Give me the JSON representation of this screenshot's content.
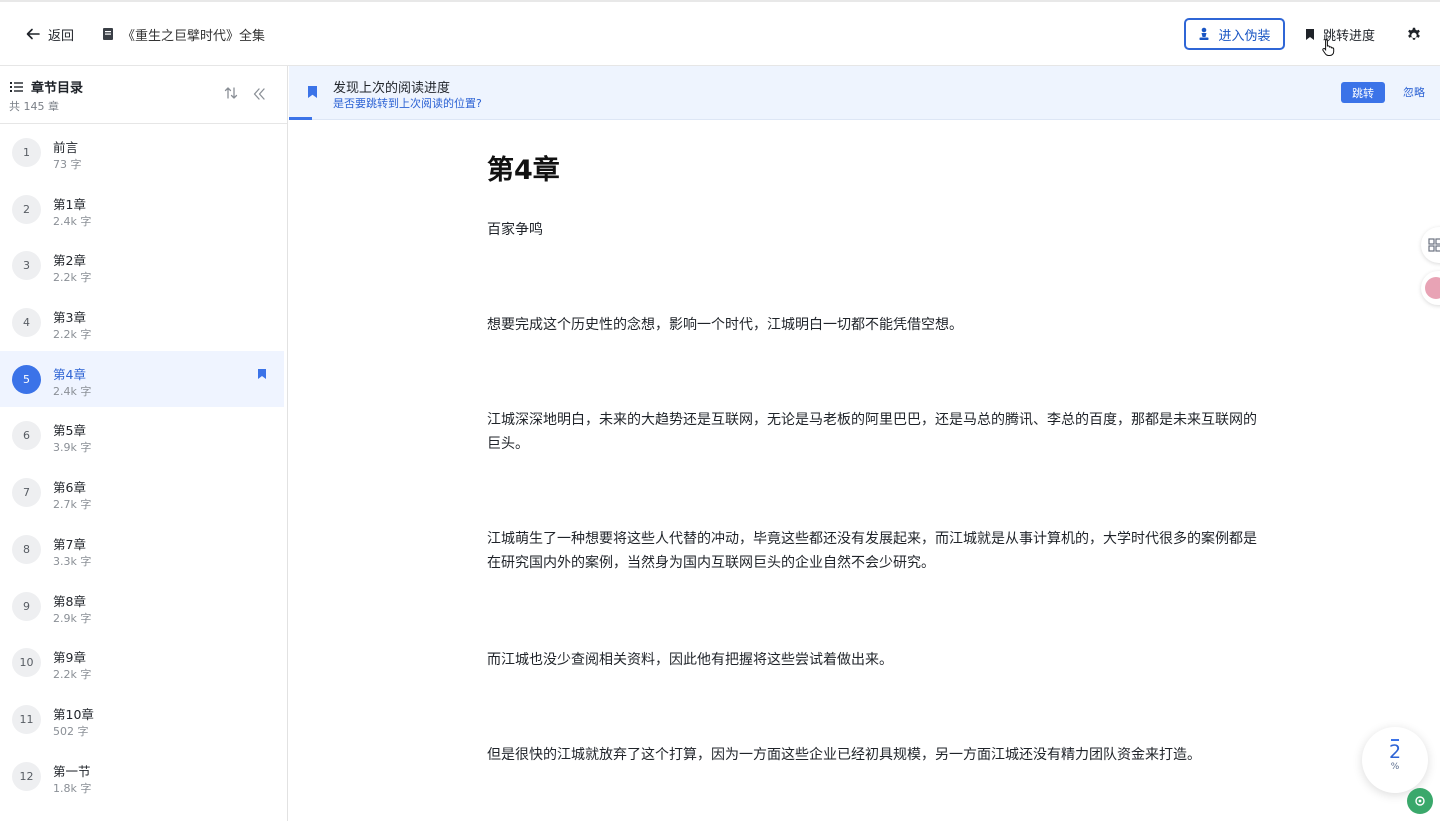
{
  "header": {
    "back_label": "返回",
    "book_title": "《重生之巨擘时代》全集",
    "disguise_label": "进入伪装",
    "jump_progress_label": "跳转进度",
    "accent_color": "#2f66d6"
  },
  "sidebar": {
    "title": "章节目录",
    "count": "共 145 章",
    "chapters": [
      {
        "num": "1",
        "title": "前言",
        "words": "73 字"
      },
      {
        "num": "2",
        "title": "第1章",
        "words": "2.4k 字"
      },
      {
        "num": "3",
        "title": "第2章",
        "words": "2.2k 字"
      },
      {
        "num": "4",
        "title": "第3章",
        "words": "2.2k 字"
      },
      {
        "num": "5",
        "title": "第4章",
        "words": "2.4k 字",
        "active": true
      },
      {
        "num": "6",
        "title": "第5章",
        "words": "3.9k 字"
      },
      {
        "num": "7",
        "title": "第6章",
        "words": "2.7k 字"
      },
      {
        "num": "8",
        "title": "第7章",
        "words": "3.3k 字"
      },
      {
        "num": "9",
        "title": "第8章",
        "words": "2.9k 字"
      },
      {
        "num": "10",
        "title": "第9章",
        "words": "2.2k 字"
      },
      {
        "num": "11",
        "title": "第10章",
        "words": "502 字"
      },
      {
        "num": "12",
        "title": "第一节",
        "words": "1.8k 字"
      }
    ]
  },
  "banner": {
    "title": "发现上次的阅读进度",
    "subtitle": "是否要跳转到上次阅读的位置?",
    "jump_label": "跳转",
    "ignore_label": "忽略"
  },
  "reader": {
    "chapter_title": "第4章",
    "paragraphs": [
      "百家争鸣",
      "想要完成这个历史性的念想，影响一个时代，江城明白一切都不能凭借空想。",
      "江城深深地明白，未来的大趋势还是互联网，无论是马老板的阿里巴巴，还是马总的腾讯、李总的百度，那都是未来互联网的巨头。",
      "江城萌生了一种想要将这些人代替的冲动，毕竟这些都还没有发展起来，而江城就是从事计算机的，大学时代很多的案例都是在研究国内外的案例，当然身为国内互联网巨头的企业自然不会少研究。",
      "而江城也没少查阅相关资料，因此他有把握将这些尝试着做出来。",
      "但是很快的江城就放弃了这个打算，因为一方面这些企业已经初具规模，另一方面江城还没有精力团队资金来打造。"
    ]
  },
  "progress": {
    "value": "2",
    "unit": "%"
  }
}
